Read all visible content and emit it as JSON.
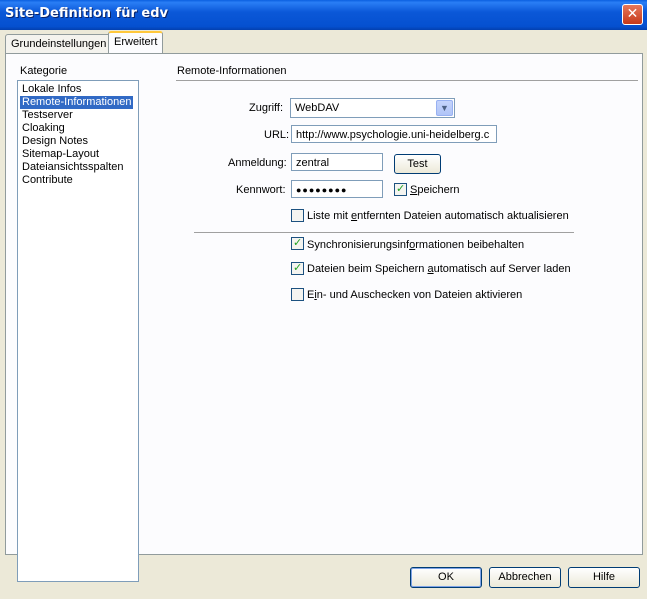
{
  "window": {
    "title": "Site-Definition für edv",
    "close_glyph": "✕"
  },
  "tabs": [
    {
      "label": "Grundeinstellungen",
      "active": false
    },
    {
      "label": "Erweitert",
      "active": true
    }
  ],
  "category": {
    "heading": "Kategorie",
    "items": [
      {
        "label": "Lokale Infos",
        "selected": false
      },
      {
        "label": "Remote-Informationen",
        "selected": true
      },
      {
        "label": "Testserver",
        "selected": false
      },
      {
        "label": "Cloaking",
        "selected": false
      },
      {
        "label": "Design Notes",
        "selected": false
      },
      {
        "label": "Sitemap-Layout",
        "selected": false
      },
      {
        "label": "Dateiansichtsspalten",
        "selected": false
      },
      {
        "label": "Contribute",
        "selected": false
      }
    ]
  },
  "section": {
    "heading": "Remote-Informationen",
    "zugriff": {
      "label": "Zugriff:",
      "value": "WebDAV"
    },
    "url": {
      "label": "URL:",
      "value": "http://www.psychologie.uni-heidelberg.c"
    },
    "anmeldung": {
      "label": "Anmeldung:",
      "value": "zentral"
    },
    "test_button": "Test",
    "kennwort": {
      "label": "Kennwort:",
      "value": "●●●●●●●●"
    },
    "speichern": {
      "label_underlined": "S",
      "label_rest": "peichern",
      "checked": true
    },
    "liste": {
      "pre": "Liste mit ",
      "u": "e",
      "post": "ntfernten Dateien automatisch aktualisieren",
      "checked": false
    },
    "sync": {
      "pre": "Synchronisierungsinf",
      "u": "o",
      "post": "rmationen beibehalten",
      "checked": true
    },
    "autoupload": {
      "pre": "Dateien beim Speichern ",
      "u": "a",
      "post": "utomatisch auf Server laden",
      "checked": true
    },
    "checkinout": {
      "pre": "E",
      "u": "i",
      "post": "n- und Auschecken von Dateien aktivieren",
      "checked": false
    }
  },
  "footer": {
    "ok": "OK",
    "cancel": "Abbrechen",
    "help": "Hilfe"
  }
}
